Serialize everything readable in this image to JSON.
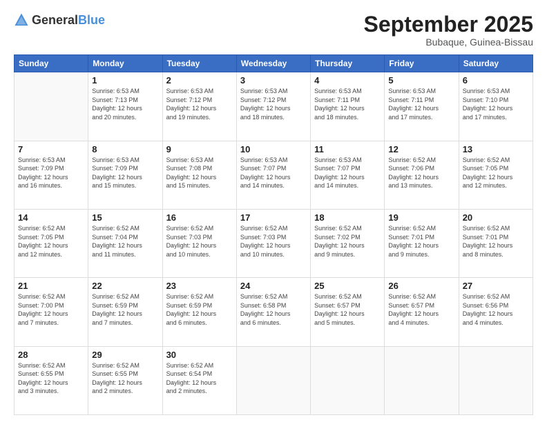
{
  "header": {
    "logo": {
      "text_general": "General",
      "text_blue": "Blue"
    },
    "title": "September 2025",
    "location": "Bubaque, Guinea-Bissau"
  },
  "calendar": {
    "days_of_week": [
      "Sunday",
      "Monday",
      "Tuesday",
      "Wednesday",
      "Thursday",
      "Friday",
      "Saturday"
    ],
    "weeks": [
      [
        {
          "day": "",
          "info": ""
        },
        {
          "day": "1",
          "info": "Sunrise: 6:53 AM\nSunset: 7:13 PM\nDaylight: 12 hours\nand 20 minutes."
        },
        {
          "day": "2",
          "info": "Sunrise: 6:53 AM\nSunset: 7:12 PM\nDaylight: 12 hours\nand 19 minutes."
        },
        {
          "day": "3",
          "info": "Sunrise: 6:53 AM\nSunset: 7:12 PM\nDaylight: 12 hours\nand 18 minutes."
        },
        {
          "day": "4",
          "info": "Sunrise: 6:53 AM\nSunset: 7:11 PM\nDaylight: 12 hours\nand 18 minutes."
        },
        {
          "day": "5",
          "info": "Sunrise: 6:53 AM\nSunset: 7:11 PM\nDaylight: 12 hours\nand 17 minutes."
        },
        {
          "day": "6",
          "info": "Sunrise: 6:53 AM\nSunset: 7:10 PM\nDaylight: 12 hours\nand 17 minutes."
        }
      ],
      [
        {
          "day": "7",
          "info": "Sunrise: 6:53 AM\nSunset: 7:09 PM\nDaylight: 12 hours\nand 16 minutes."
        },
        {
          "day": "8",
          "info": "Sunrise: 6:53 AM\nSunset: 7:09 PM\nDaylight: 12 hours\nand 15 minutes."
        },
        {
          "day": "9",
          "info": "Sunrise: 6:53 AM\nSunset: 7:08 PM\nDaylight: 12 hours\nand 15 minutes."
        },
        {
          "day": "10",
          "info": "Sunrise: 6:53 AM\nSunset: 7:07 PM\nDaylight: 12 hours\nand 14 minutes."
        },
        {
          "day": "11",
          "info": "Sunrise: 6:53 AM\nSunset: 7:07 PM\nDaylight: 12 hours\nand 14 minutes."
        },
        {
          "day": "12",
          "info": "Sunrise: 6:52 AM\nSunset: 7:06 PM\nDaylight: 12 hours\nand 13 minutes."
        },
        {
          "day": "13",
          "info": "Sunrise: 6:52 AM\nSunset: 7:05 PM\nDaylight: 12 hours\nand 12 minutes."
        }
      ],
      [
        {
          "day": "14",
          "info": "Sunrise: 6:52 AM\nSunset: 7:05 PM\nDaylight: 12 hours\nand 12 minutes."
        },
        {
          "day": "15",
          "info": "Sunrise: 6:52 AM\nSunset: 7:04 PM\nDaylight: 12 hours\nand 11 minutes."
        },
        {
          "day": "16",
          "info": "Sunrise: 6:52 AM\nSunset: 7:03 PM\nDaylight: 12 hours\nand 10 minutes."
        },
        {
          "day": "17",
          "info": "Sunrise: 6:52 AM\nSunset: 7:03 PM\nDaylight: 12 hours\nand 10 minutes."
        },
        {
          "day": "18",
          "info": "Sunrise: 6:52 AM\nSunset: 7:02 PM\nDaylight: 12 hours\nand 9 minutes."
        },
        {
          "day": "19",
          "info": "Sunrise: 6:52 AM\nSunset: 7:01 PM\nDaylight: 12 hours\nand 9 minutes."
        },
        {
          "day": "20",
          "info": "Sunrise: 6:52 AM\nSunset: 7:01 PM\nDaylight: 12 hours\nand 8 minutes."
        }
      ],
      [
        {
          "day": "21",
          "info": "Sunrise: 6:52 AM\nSunset: 7:00 PM\nDaylight: 12 hours\nand 7 minutes."
        },
        {
          "day": "22",
          "info": "Sunrise: 6:52 AM\nSunset: 6:59 PM\nDaylight: 12 hours\nand 7 minutes."
        },
        {
          "day": "23",
          "info": "Sunrise: 6:52 AM\nSunset: 6:59 PM\nDaylight: 12 hours\nand 6 minutes."
        },
        {
          "day": "24",
          "info": "Sunrise: 6:52 AM\nSunset: 6:58 PM\nDaylight: 12 hours\nand 6 minutes."
        },
        {
          "day": "25",
          "info": "Sunrise: 6:52 AM\nSunset: 6:57 PM\nDaylight: 12 hours\nand 5 minutes."
        },
        {
          "day": "26",
          "info": "Sunrise: 6:52 AM\nSunset: 6:57 PM\nDaylight: 12 hours\nand 4 minutes."
        },
        {
          "day": "27",
          "info": "Sunrise: 6:52 AM\nSunset: 6:56 PM\nDaylight: 12 hours\nand 4 minutes."
        }
      ],
      [
        {
          "day": "28",
          "info": "Sunrise: 6:52 AM\nSunset: 6:55 PM\nDaylight: 12 hours\nand 3 minutes."
        },
        {
          "day": "29",
          "info": "Sunrise: 6:52 AM\nSunset: 6:55 PM\nDaylight: 12 hours\nand 2 minutes."
        },
        {
          "day": "30",
          "info": "Sunrise: 6:52 AM\nSunset: 6:54 PM\nDaylight: 12 hours\nand 2 minutes."
        },
        {
          "day": "",
          "info": ""
        },
        {
          "day": "",
          "info": ""
        },
        {
          "day": "",
          "info": ""
        },
        {
          "day": "",
          "info": ""
        }
      ]
    ]
  }
}
